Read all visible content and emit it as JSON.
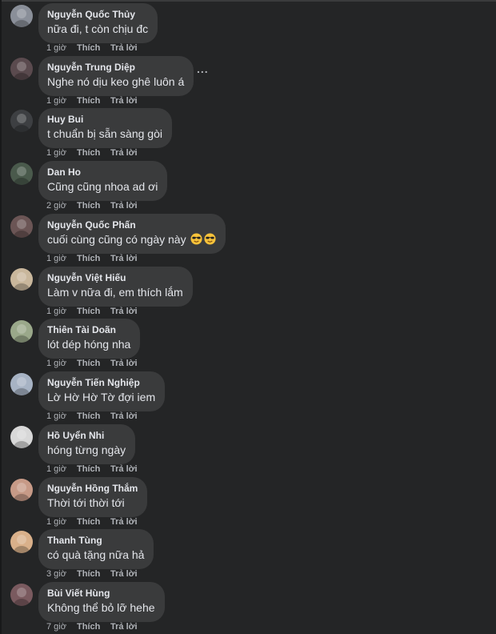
{
  "comments": [
    {
      "author": "Nguyễn Quốc Thủy",
      "text": "nữa đi, t còn chịu đc",
      "time": "1 giờ",
      "like": "Thích",
      "reply": "Trả lời",
      "avatar_color": "#8a8f99"
    },
    {
      "author": "Nguyễn Trung Diệp",
      "text": "Nghe nó dịu keo ghê luôn á",
      "time": "1 giờ",
      "like": "Thích",
      "reply": "Trả lời",
      "avatar_color": "#5a4a4e"
    },
    {
      "author": "Huy Bui",
      "text": "t chuẩn bị sẵn sàng gòi",
      "time": "1 giờ",
      "like": "Thích",
      "reply": "Trả lời",
      "avatar_color": "#3d3f42"
    },
    {
      "author": "Dan Ho",
      "text": "Cũng cũng nhoa ad ơi",
      "time": "2 giờ",
      "like": "Thích",
      "reply": "Trả lời",
      "avatar_color": "#4a5a4c"
    },
    {
      "author": "Nguyễn Quốc Phấn",
      "text": "cuối cùng cũng có ngày này",
      "emoji_count": 2,
      "time": "1 giờ",
      "like": "Thích",
      "reply": "Trả lời",
      "avatar_color": "#6b5555"
    },
    {
      "author": "Nguyễn Việt Hiếu",
      "text": "Làm v nữa đi, em thích lắm",
      "time": "1 giờ",
      "like": "Thích",
      "reply": "Trả lời",
      "avatar_color": "#c9b79c"
    },
    {
      "author": "Thiên Tài Doãn",
      "text": "lót dép hóng nha",
      "time": "1 giờ",
      "like": "Thích",
      "reply": "Trả lời",
      "avatar_color": "#9aa88a"
    },
    {
      "author": "Nguyễn Tiến Nghiệp",
      "text": "Lờ Hờ Hờ Tờ đợi iem",
      "time": "1 giờ",
      "like": "Thích",
      "reply": "Trả lời",
      "avatar_color": "#a7b3c4"
    },
    {
      "author": "Hồ Uyển Nhi",
      "text": "hóng từng ngày",
      "time": "1 giờ",
      "like": "Thích",
      "reply": "Trả lời",
      "avatar_color": "#d8d8d8"
    },
    {
      "author": "Nguyễn Hồng Thắm",
      "text": "Thời tới thời tới",
      "time": "1 giờ",
      "like": "Thích",
      "reply": "Trả lời",
      "avatar_color": "#c79a87"
    },
    {
      "author": "Thanh Tùng",
      "text": "có quà tặng nữa hả",
      "time": "3 giờ",
      "like": "Thích",
      "reply": "Trả lời",
      "avatar_color": "#d9b08a"
    },
    {
      "author": "Bùi Viết Hùng",
      "text": "Không thể bỏ lỡ hehe",
      "time": "7 giờ",
      "like": "Thích",
      "reply": "Trả lời",
      "avatar_color": "#7a5a5f"
    }
  ],
  "more_options": "...",
  "colors": {
    "background": "#242526",
    "bubble": "#3a3b3c",
    "text": "#e4e6eb",
    "secondary": "#b0b3b8"
  }
}
